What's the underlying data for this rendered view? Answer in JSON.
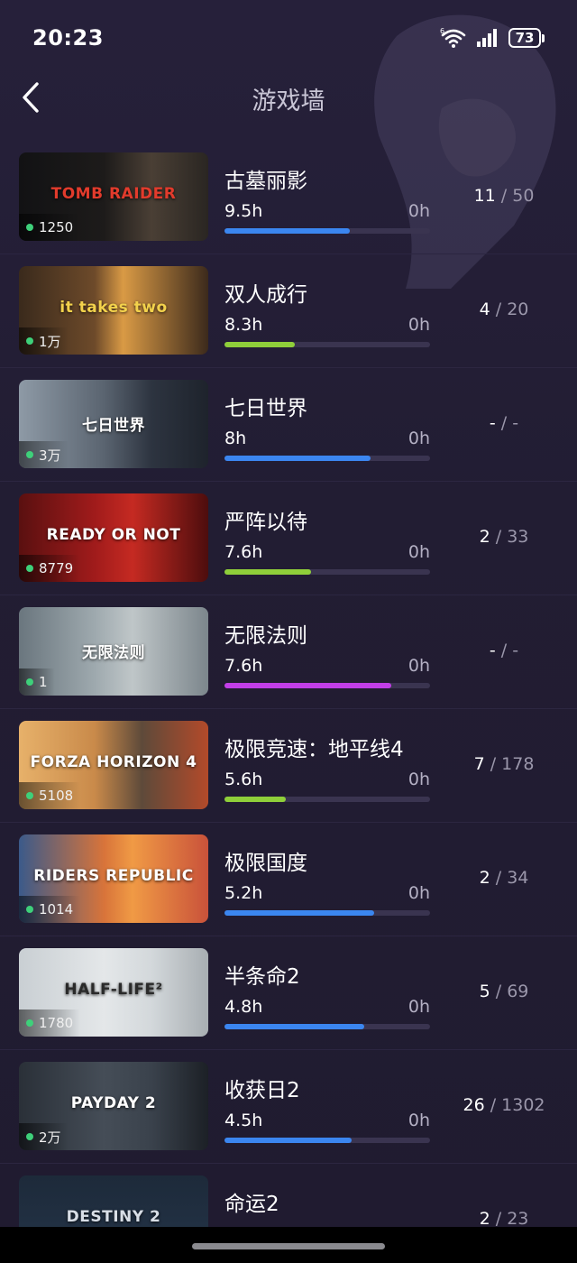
{
  "status_bar": {
    "time": "20:23",
    "battery": "73",
    "wifi_icon": "wifi-6-icon",
    "signal_icon": "cellular-signal-icon"
  },
  "header": {
    "title": "游戏墙",
    "back_icon": "chevron-left-icon"
  },
  "colors": {
    "blue": "#3b86f0",
    "green": "#8fcf3a",
    "purple": "#c23ee8"
  },
  "games": [
    {
      "name": "古墓丽影",
      "hours": "9.5h",
      "zero": "0h",
      "progress": 0.61,
      "bar_color": "#3b86f0",
      "players": "1250",
      "ach_got": "11",
      "ach_sep": " / ",
      "ach_total": "50",
      "logo": "TOMB RAIDER",
      "art": "linear-gradient(90deg,#121214 0%,#1d1b1a 45%,#4a3f35 70%,#2a2622 100%)",
      "logo_color": "#e23b2c"
    },
    {
      "name": "双人成行",
      "hours": "8.3h",
      "zero": "0h",
      "progress": 0.34,
      "bar_color": "#8fcf3a",
      "players": "1万",
      "ach_got": "4",
      "ach_sep": " / ",
      "ach_total": "20",
      "logo": "it takes two",
      "art": "linear-gradient(90deg,#3a2a1c 0%,#6d4a2a 40%,#d99a45 55%,#3c2a1c 100%)",
      "logo_color": "#f3d24c"
    },
    {
      "name": "七日世界",
      "hours": "8h",
      "zero": "0h",
      "progress": 0.71,
      "bar_color": "#3b86f0",
      "players": "3万",
      "ach_got": "-",
      "ach_sep": " / ",
      "ach_total": "-",
      "logo": "七日世界",
      "art": "linear-gradient(90deg,#8e9aa6 0%,#5a6470 45%,#2d3440 70%,#1e232c 100%)",
      "logo_color": "#ffffff"
    },
    {
      "name": "严阵以待",
      "hours": "7.6h",
      "zero": "0h",
      "progress": 0.42,
      "bar_color": "#8fcf3a",
      "players": "8779",
      "ach_got": "2",
      "ach_sep": " / ",
      "ach_total": "33",
      "logo": "READY OR NOT",
      "art": "linear-gradient(90deg,#5a1010 0%,#a01b1b 40%,#c52a22 60%,#4d0d0d 100%)",
      "logo_color": "#ffffff"
    },
    {
      "name": "无限法则",
      "hours": "7.6h",
      "zero": "0h",
      "progress": 0.81,
      "bar_color": "#c23ee8",
      "players": "1",
      "ach_got": "-",
      "ach_sep": " / ",
      "ach_total": "-",
      "logo": "无限法则",
      "art": "linear-gradient(90deg,#6a767e 0%,#9ea9ae 40%,#bfc6c8 60%,#7c868c 100%)",
      "logo_color": "#ffffff"
    },
    {
      "name": "极限竞速：地平线4",
      "hours": "5.6h",
      "zero": "0h",
      "progress": 0.3,
      "bar_color": "#8fcf3a",
      "players": "5108",
      "ach_got": "7",
      "ach_sep": " / ",
      "ach_total": "178",
      "logo": "FORZA HORIZON 4",
      "art": "linear-gradient(90deg,#e7b16a 0%,#c98a4a 40%,#5e4a3a 65%,#b34a2a 100%)",
      "logo_color": "#ffffff"
    },
    {
      "name": "极限国度",
      "hours": "5.2h",
      "zero": "0h",
      "progress": 0.73,
      "bar_color": "#3b86f0",
      "players": "1014",
      "ach_got": "2",
      "ach_sep": " / ",
      "ach_total": "34",
      "logo": "RIDERS REPUBLIC",
      "art": "linear-gradient(90deg,#3b5a8a 0%,#d8743a 45%,#f09a45 60%,#c9523a 100%)",
      "logo_color": "#ffffff"
    },
    {
      "name": "半条命2",
      "hours": "4.8h",
      "zero": "0h",
      "progress": 0.68,
      "bar_color": "#3b86f0",
      "players": "1780",
      "ach_got": "5",
      "ach_sep": " / ",
      "ach_total": "69",
      "logo": "HALF-LIFE²",
      "art": "linear-gradient(90deg,#c9cfd3 0%,#e4e7e9 45%,#d3d8db 70%,#a8aeb2 100%)",
      "logo_color": "#2a2a2a"
    },
    {
      "name": "收获日2",
      "hours": "4.5h",
      "zero": "0h",
      "progress": 0.62,
      "bar_color": "#3b86f0",
      "players": "2万",
      "ach_got": "26",
      "ach_sep": " / ",
      "ach_total": "1302",
      "logo": "PAYDAY 2",
      "art": "linear-gradient(90deg,#2a3038 0%,#454d57 45%,#3a424c 70%,#1c2026 100%)",
      "logo_color": "#ffffff"
    },
    {
      "name": "命运2",
      "hours": "",
      "zero": "",
      "progress": 0,
      "bar_color": "#3b86f0",
      "players": "",
      "ach_got": "2",
      "ach_sep": " / ",
      "ach_total": "23",
      "logo": "DESTINY 2",
      "art": "linear-gradient(180deg,#1d2a3a 0%,#243448 100%)",
      "logo_color": "#d8dee6"
    }
  ]
}
